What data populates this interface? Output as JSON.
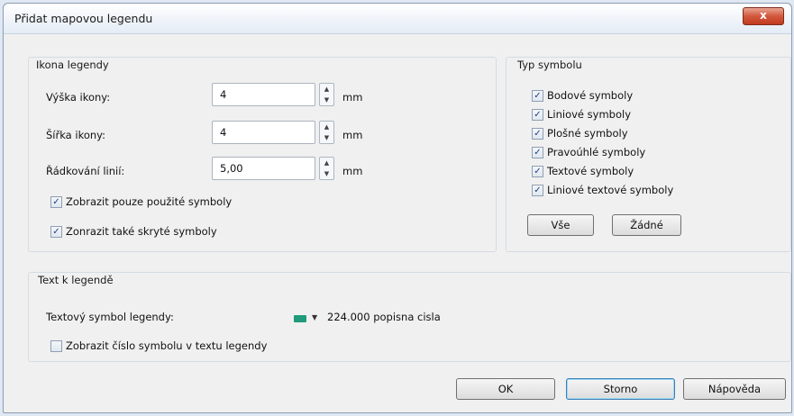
{
  "window": {
    "title": "Přidat mapovou legendu",
    "close_label": "x"
  },
  "icon_group": {
    "title": "Ikona legendy",
    "fields": [
      {
        "label": "Výška ikony:",
        "value": "4",
        "unit": "mm"
      },
      {
        "label": "Šířka ikony:",
        "value": "4",
        "unit": "mm"
      },
      {
        "label": "Řádkování linií:",
        "value": "5,00",
        "unit": "mm"
      }
    ],
    "checkboxes": [
      {
        "label": "Zobrazit pouze použité symboly",
        "checked": true
      },
      {
        "label": "Zonrazit také skryté symboly",
        "checked": true
      }
    ]
  },
  "symbol_type_group": {
    "title": "Typ symbolu",
    "checkboxes": [
      {
        "label": "Bodové symboly",
        "checked": true
      },
      {
        "label": "Liniové symboly",
        "checked": true
      },
      {
        "label": "Plošné symboly",
        "checked": true
      },
      {
        "label": "Pravoúhlé symboly",
        "checked": true
      },
      {
        "label": "Textové symboly",
        "checked": true
      },
      {
        "label": "Liniové textové symboly",
        "checked": true
      }
    ],
    "all_button": "Vše",
    "none_button": "Žádné"
  },
  "text_group": {
    "title": "Text k legendě",
    "symbol_label": "Textový symbol legendy:",
    "symbol_value": "224.000 popisna cisla",
    "show_number_label": "Zobrazit číslo symbolu v textu legendy",
    "show_number_checked": false
  },
  "buttons": {
    "ok": "OK",
    "cancel": "Storno",
    "help": "Nápověda"
  },
  "check_glyph": "✓",
  "spin_up": "▲",
  "spin_down": "▼",
  "dropdown_glyph": "▼"
}
